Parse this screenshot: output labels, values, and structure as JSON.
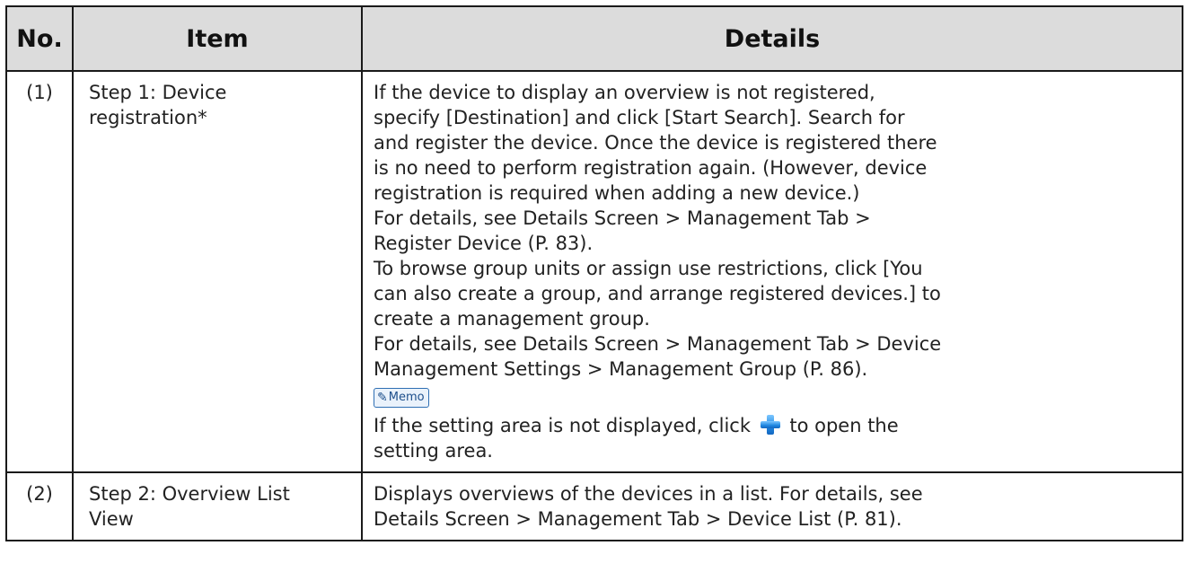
{
  "table": {
    "headers": {
      "no": "No.",
      "item": "Item",
      "details": "Details"
    },
    "rows": [
      {
        "no": "(1)",
        "item_lines": [
          "Step 1: Device",
          "registration*"
        ],
        "details_lines": [
          "If the device to display an overview is not registered,",
          "specify [Destination] and click [Start Search]. Search for",
          "and register the device. Once the device is registered there",
          "is no need to perform registration again. (However, device",
          "registration is required when adding a new device.)",
          "For details, see Details Screen > Management Tab >",
          "Register Device (P. 83).",
          "To browse group units or assign use restrictions, click [You",
          "can also create a group, and arrange registered devices.] to",
          "create a management group.",
          "For details, see Details Screen > Management Tab > Device",
          "Management Settings > Management Group (P. 86)."
        ],
        "memo": {
          "badge_label": "Memo",
          "icon": "pencil-icon",
          "text_before": "If the setting area is not displayed, click ",
          "plus_icon": "plus-icon",
          "text_after": " to open the",
          "text_line2": "setting area."
        }
      },
      {
        "no": "(2)",
        "item_lines": [
          "Step 2: Overview List",
          "View"
        ],
        "details_lines": [
          "Displays overviews of the devices in a list. For details, see",
          "Details Screen > Management Tab > Device List (P. 81)."
        ]
      }
    ]
  },
  "colors": {
    "header_bg": "#dcdcdc",
    "border": "#1a1a1a",
    "memo_accent": "#2f6fb3",
    "plus_icon": "#1f86e0"
  }
}
